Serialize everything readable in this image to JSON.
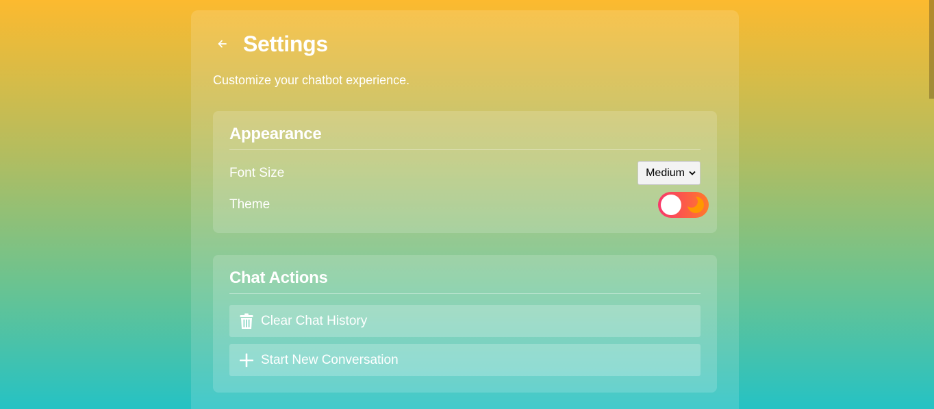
{
  "header": {
    "title": "Settings",
    "subtitle": "Customize your chatbot experience."
  },
  "appearance": {
    "title": "Appearance",
    "font_size_label": "Font Size",
    "font_size_value": "Medium",
    "theme_label": "Theme",
    "theme_toggle_state": "off"
  },
  "chat_actions": {
    "title": "Chat Actions",
    "clear_label": "Clear Chat History",
    "new_label": "Start New Conversation"
  },
  "icons": {
    "back": "arrow-left-icon",
    "select": "chevron-down-icon",
    "theme": "moon-icon",
    "clear": "trash-icon",
    "new": "plus-icon"
  },
  "colors": {
    "bg_top": "#fcba2f",
    "bg_bottom": "#25c2c4",
    "toggle_start": "#f8386b",
    "toggle_end": "#ff7a2a",
    "moon": "#ff9800"
  }
}
